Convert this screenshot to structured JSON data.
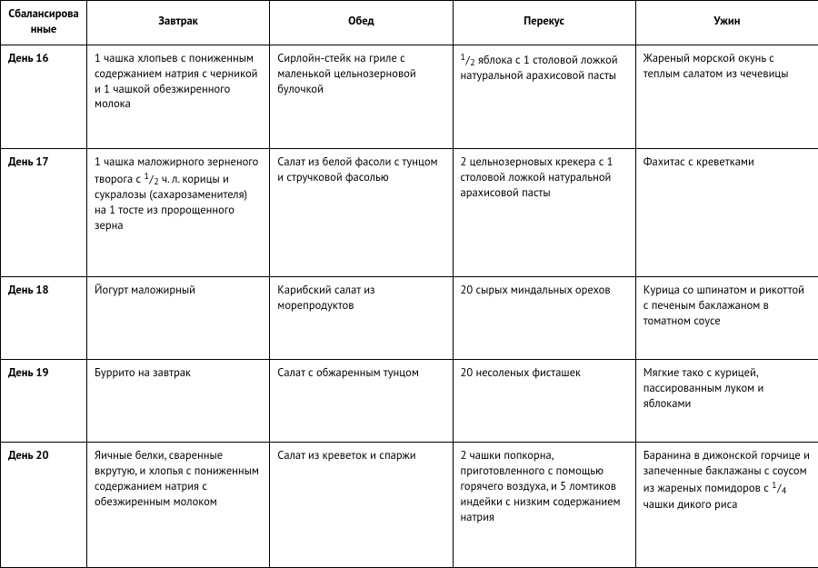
{
  "headers": [
    "Сбалансированные",
    "Завтрак",
    "Обед",
    "Перекус",
    "Ужин"
  ],
  "rows": [
    {
      "day": "День 16",
      "breakfast_pre": "1 чашка хлопьев с пониженным содержанием натрия с черникой и 1 чашкой обезжиренного молока",
      "lunch": "Сирлойн-стейк на гриле с маленькой цельнозерновой булочкой",
      "snack_frac": {
        "n": "1",
        "d": "2"
      },
      "snack_post": " яблока с 1 столовой ложкой натуральной арахисовой пасты",
      "dinner": "Жареный морской окунь с теплым салатом из чечевицы"
    },
    {
      "day": "День 17",
      "breakfast_pre": "1 чашка маложирного зерненого творога с ",
      "breakfast_frac": {
        "n": "1",
        "d": "2"
      },
      "breakfast_post": " ч. л. корицы и сукралозы (сахарозаменителя) на 1 тосте из пророщенного зерна",
      "lunch": "Салат из белой фасоли с тунцом и стручковой фасолью",
      "snack": "2 цельнозерновых крекера с 1 столовой ложкой натуральной арахисовой пасты",
      "dinner": "Фахитас с креветками"
    },
    {
      "day": "День 18",
      "breakfast": "Йогурт маложирный",
      "lunch": "Карибский салат из морепродуктов",
      "snack": "20 сырых миндальных орехов",
      "dinner": "Курица со шпинатом и рикоттой с печеным баклажаном в томатном соусе"
    },
    {
      "day": "День 19",
      "breakfast": "Буррито на завтрак",
      "lunch": "Салат с обжаренным тунцом",
      "snack": "20 несоленых фисташек",
      "dinner": "Мягкие тако с курицей, пассированным луком и яблоками"
    },
    {
      "day": "День 20",
      "breakfast": "Яичные белки, сваренные вкрутую, и хлопья с пониженным содержанием натрия с обезжиренным молоком",
      "lunch": "Салат из креветок и спаржи",
      "snack": "2 чашки попкорна, приготовленного с помощью горячего воздуха, и 5 ломтиков индейки с низким содержанием натрия",
      "dinner_pre": "Баранина в дижонской горчице и запеченные баклажаны с соусом из жареных помидоров с ",
      "dinner_frac": {
        "n": "1",
        "d": "4"
      },
      "dinner_post": " чашки дикого риса"
    }
  ]
}
